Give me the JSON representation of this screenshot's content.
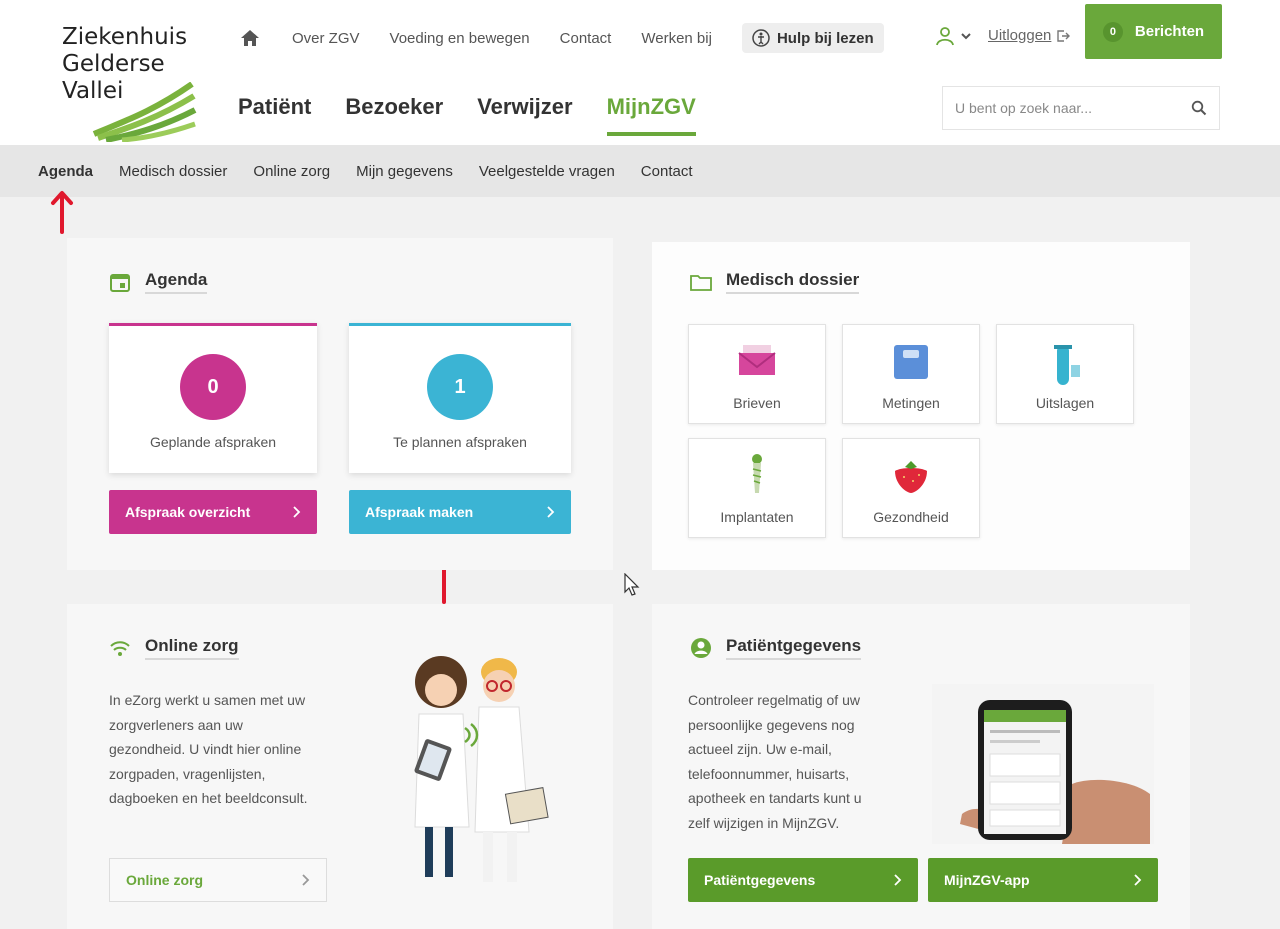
{
  "logo": {
    "line1": "Ziekenhuis",
    "line2": "Gelderse",
    "line3": "Vallei",
    "icon": "wave-logo-icon"
  },
  "topnav": {
    "home_icon": "home-icon",
    "links": [
      "Over ZGV",
      "Voeding en bewegen",
      "Contact",
      "Werken bij"
    ],
    "help_label": "Hulp bij lezen",
    "logout_label": "Uitloggen",
    "messages_label": "Berichten",
    "messages_count": "0"
  },
  "mainnav": {
    "items": [
      "Patiënt",
      "Bezoeker",
      "Verwijzer",
      "MijnZGV"
    ],
    "active": "MijnZGV"
  },
  "search": {
    "placeholder": "U bent op zoek naar..."
  },
  "subnav": {
    "items": [
      "Agenda",
      "Medisch dossier",
      "Online zorg",
      "Mijn gegevens",
      "Veelgestelde vragen",
      "Contact"
    ],
    "active": "Agenda"
  },
  "agenda": {
    "title": "Agenda",
    "planned": {
      "count": "0",
      "label": "Geplande afspraken",
      "color": "#c8348e"
    },
    "to_plan": {
      "count": "1",
      "label": "Te plannen afspraken",
      "color": "#3bb4d4"
    },
    "btn_overview": "Afspraak overzicht",
    "btn_make": "Afspraak maken"
  },
  "dossier": {
    "title": "Medisch dossier",
    "tiles": [
      "Brieven",
      "Metingen",
      "Uitslagen",
      "Implantaten",
      "Gezondheid"
    ]
  },
  "online_zorg": {
    "title": "Online zorg",
    "lines": [
      "In eZorg werkt u samen met uw",
      "zorgverleners aan uw",
      "gezondheid. U vindt hier online",
      "zorgpaden, vragenlijsten,",
      "dagboeken en het beeldconsult."
    ],
    "button": "Online zorg"
  },
  "patient": {
    "title": "Patiëntgegevens",
    "lines": [
      "Controleer regelmatig of uw",
      "persoonlijke gegevens nog",
      "actueel zijn. Uw e-mail,",
      "telefoonnummer, huisarts,",
      "apotheek en tandarts kunt u",
      "zelf wijzigen in MijnZGV."
    ],
    "btn_data": "Patiëntgegevens",
    "btn_app": "MijnZGV-app"
  },
  "colors": {
    "green": "#6aa83b",
    "magenta": "#c8348e",
    "cyan": "#3bb4d4",
    "arrow": "#e0182d"
  }
}
